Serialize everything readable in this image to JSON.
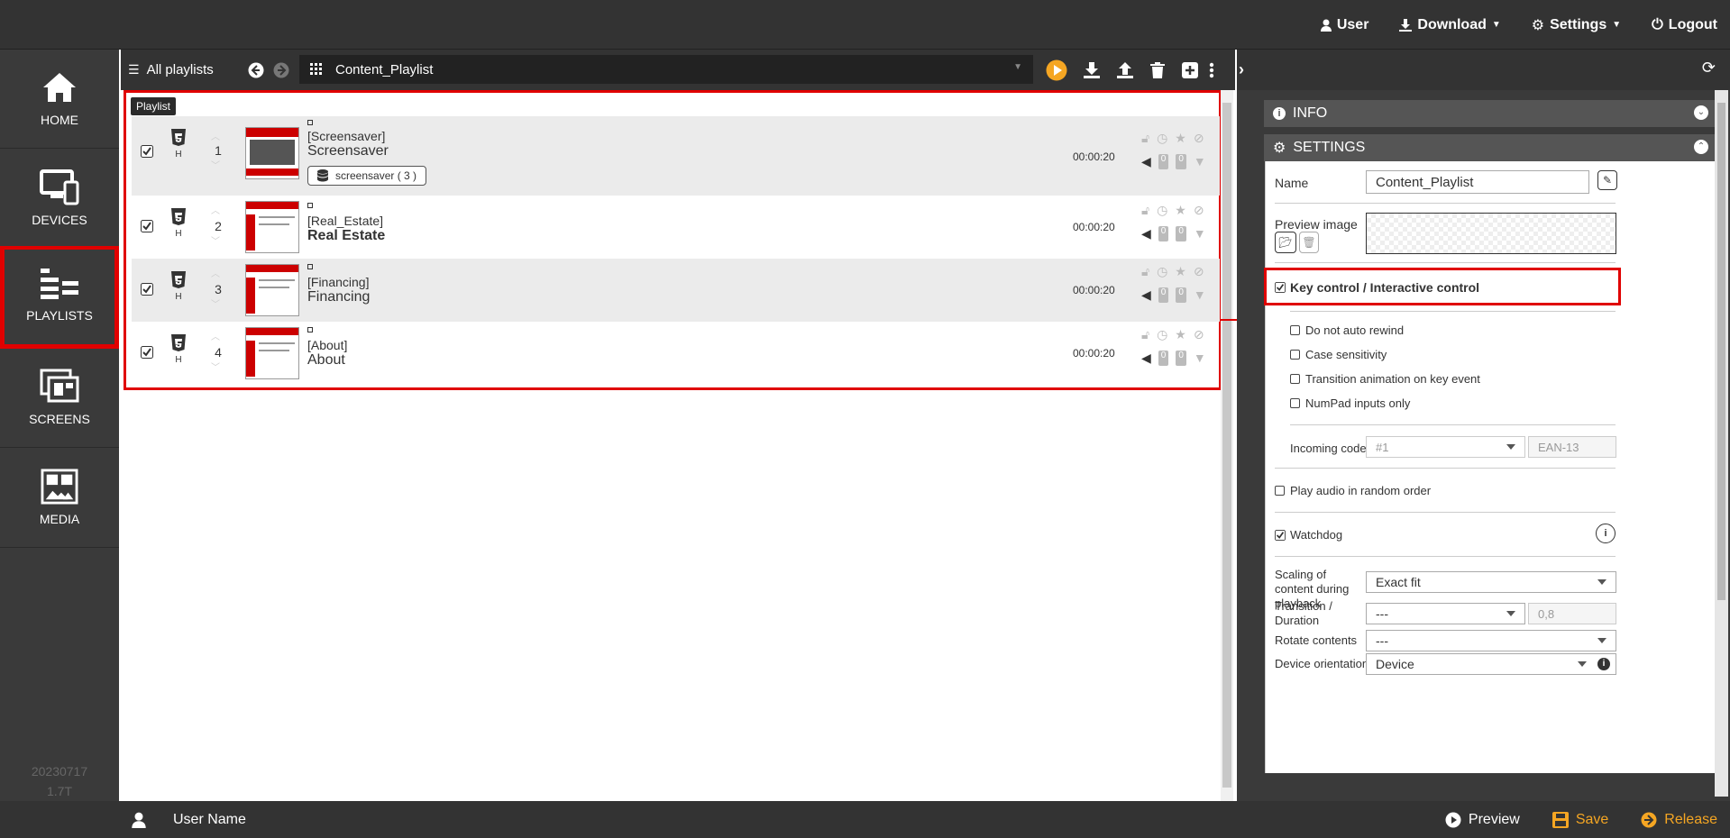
{
  "topbar": {
    "user": "User",
    "download": "Download",
    "settings": "Settings",
    "logout": "Logout"
  },
  "sidebar": {
    "items": [
      {
        "label": "HOME"
      },
      {
        "label": "DEVICES"
      },
      {
        "label": "PLAYLISTS"
      },
      {
        "label": "SCREENS"
      },
      {
        "label": "MEDIA"
      }
    ],
    "version_line1": "20230717",
    "version_line2": "1.7T"
  },
  "toolbar": {
    "all_playlists": "All playlists",
    "selected_playlist": "Content_Playlist"
  },
  "playlist": {
    "tag": "Playlist",
    "rows": [
      {
        "num": "1",
        "tag": "[Screensaver]",
        "title": "Screensaver",
        "sub": "screensaver ( 3 )",
        "duration": "00:00:20",
        "h": "H"
      },
      {
        "num": "2",
        "tag": "[Real_Estate]",
        "title": "Real Estate",
        "duration": "00:00:20",
        "h": "H"
      },
      {
        "num": "3",
        "tag": "[Financing]",
        "title": "Financing",
        "duration": "00:00:20",
        "h": "H"
      },
      {
        "num": "4",
        "tag": "[About]",
        "title": "About",
        "duration": "00:00:20",
        "h": "H"
      }
    ],
    "counter": "0"
  },
  "rightpanel": {
    "info_title": "INFO",
    "settings_title": "SETTINGS",
    "name_label": "Name",
    "name_value": "Content_Playlist",
    "preview_label": "Preview image",
    "key_control": "Key control / Interactive control",
    "opt1": "Do not auto rewind",
    "opt2": "Case sensitivity",
    "opt3": "Transition animation on key event",
    "opt4": "NumPad inputs only",
    "incoming_label": "Incoming codes",
    "incoming_value": "#1",
    "incoming_type": "EAN-13",
    "random_audio": "Play audio in random order",
    "watchdog": "Watchdog",
    "scaling_label": "Scaling of content during playback",
    "scaling_value": "Exact fit",
    "transition_label": "Transition / Duration",
    "transition_value": "---",
    "transition_duration": "0,8",
    "rotate_label": "Rotate contents",
    "rotate_value": "---",
    "orientation_label": "Device orientation",
    "orientation_value": "Device"
  },
  "bottombar": {
    "user_name": "User Name",
    "preview": "Preview",
    "save": "Save",
    "release": "Release"
  },
  "colors": {
    "accent_orange": "#f5a623",
    "highlight_red": "#e00000",
    "dark_bg": "#333333"
  }
}
